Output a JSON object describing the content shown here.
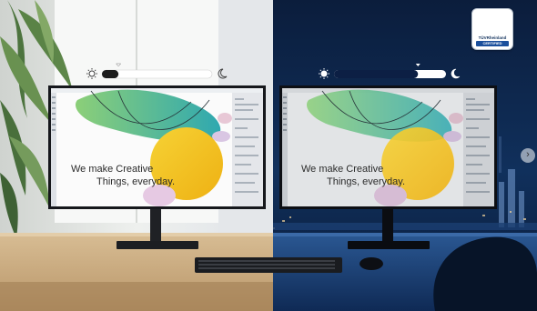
{
  "screen_text": {
    "left": {
      "line1": "We make Creative",
      "line2": "Things, everyday."
    },
    "right": {
      "line1": "We make Creative",
      "line2": "Things, everyday."
    }
  },
  "badge": {
    "brand": "TÜVRheinland",
    "label": "CERTIFIED"
  },
  "brightness": {
    "left_level": 0.15,
    "right_level": 0.75
  },
  "icons": [
    "sun-icon",
    "moon-icon",
    "tuv-check-icon",
    "chevron-right-icon"
  ],
  "colors": {
    "day_wall": "#e9ebe9",
    "night_wall": "#0c2244",
    "desk_day": "#c8ab82",
    "desk_night": "#1a3a6c",
    "monitor": "#1b1d22",
    "artwork_yellow": "#f2c21a",
    "artwork_teal": "#47b8a3"
  }
}
